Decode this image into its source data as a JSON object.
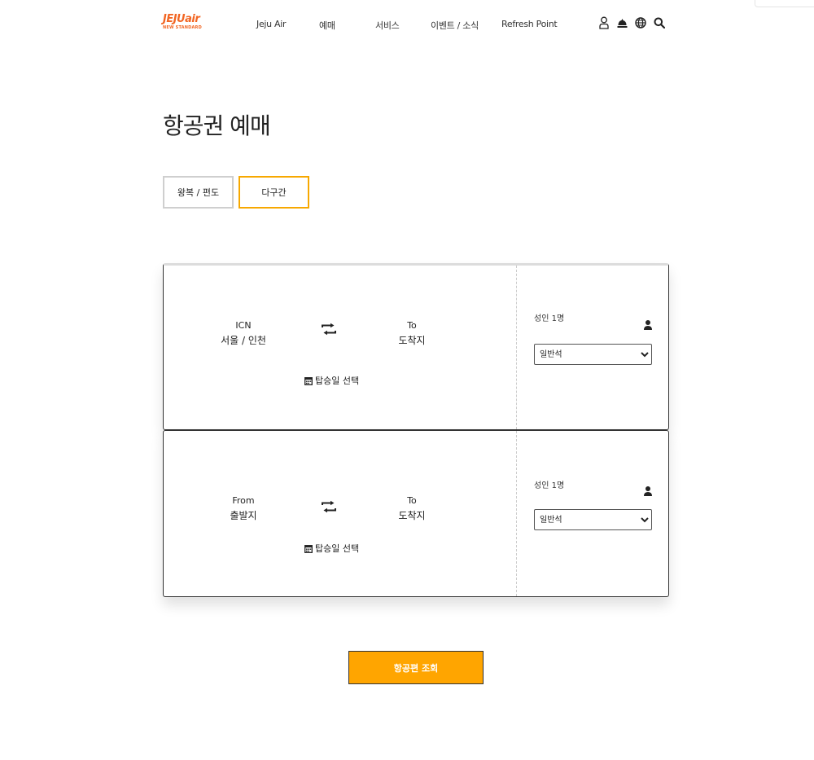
{
  "header": {
    "logo_main": "JEJUair",
    "logo_sub": "NEW STANDARD",
    "nav": [
      "Jeju Air",
      "예매",
      "서비스",
      "이벤트 / 소식",
      "Refresh Point"
    ],
    "icons": [
      "user-icon",
      "bell-icon",
      "globe-icon",
      "search-icon"
    ]
  },
  "page": {
    "title": "항공권 예매"
  },
  "trip_type": {
    "round_trip": "왕복 / 편도",
    "multi_city": "다구간",
    "selected": "multi_city"
  },
  "segments": [
    {
      "from_code": "ICN",
      "from_city": "서울 / 인천",
      "to_code": "To",
      "to_city": "도착지",
      "date_label": "탑승일 선택",
      "pax_label": "성인 1명",
      "seat_class": "일반석"
    },
    {
      "from_code": "From",
      "from_city": "출발지",
      "to_code": "To",
      "to_city": "도착지",
      "date_label": "탑승일 선택",
      "pax_label": "성인 1명",
      "seat_class": "일반석"
    }
  ],
  "search_button": "항공편 조회",
  "colors": {
    "brand": "#f26522",
    "accent": "#ffa500",
    "active_border": "#f7a800"
  }
}
